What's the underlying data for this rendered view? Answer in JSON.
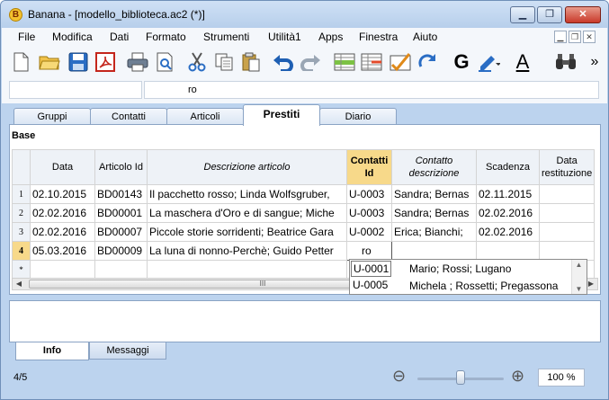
{
  "window": {
    "title": "Banana - [modello_biblioteca.ac2 (*)]",
    "minimize": "▁",
    "restore": "❐",
    "close": "✕"
  },
  "menubar": {
    "items": [
      "File",
      "Modifica",
      "Dati",
      "Formato",
      "Strumenti",
      "Utilità1",
      "Apps",
      "Finestra",
      "Aiuto"
    ],
    "mdi": [
      "▁",
      "❐",
      "✕"
    ]
  },
  "toolbar": {
    "icons": [
      "new-file-icon",
      "open-folder-icon",
      "save-icon",
      "pdf-icon",
      "print-icon",
      "print-preview-icon",
      "cut-icon",
      "copy-icon",
      "paste-icon",
      "undo-icon",
      "redo-icon",
      "insert-row-icon",
      "delete-row-icon",
      "check-icon",
      "refresh-icon",
      "bold-icon",
      "highlight-icon",
      "font-color-icon",
      "find-icon",
      "more-icon"
    ],
    "bold_label": "G",
    "font_color_label": "A",
    "more_label": "»"
  },
  "formula_bar": {
    "cell_ref": "",
    "value": "ro"
  },
  "tabs": [
    "Gruppi",
    "Contatti",
    "Articoli",
    "Prestiti",
    "Diario"
  ],
  "active_tab": "Prestiti",
  "section_label": "Base",
  "table": {
    "headers": [
      "Data",
      "Articolo Id",
      "Descrizione articolo",
      "Contatti Id",
      "Contatto descrizione",
      "Scadenza",
      "Data restituzione"
    ],
    "rows": [
      {
        "n": "1",
        "data": "02.10.2015",
        "articolo": "BD00143",
        "descrizione": "Il pacchetto rosso; Linda Wolfsgruber,",
        "contatti": "U-0003",
        "contatto_desc": "Sandra; Bernas",
        "scadenza": "02.11.2015",
        "restituzione": ""
      },
      {
        "n": "2",
        "data": "02.02.2016",
        "articolo": "BD00001",
        "descrizione": "La maschera d'Oro e di sangue; Miche",
        "contatti": "U-0003",
        "contatto_desc": "Sandra; Bernas",
        "scadenza": "02.02.2016",
        "restituzione": ""
      },
      {
        "n": "3",
        "data": "02.02.2016",
        "articolo": "BD00007",
        "descrizione": "Piccole storie sorridenti; Beatrice Gara",
        "contatti": "U-0002",
        "contatto_desc": "Erica; Bianchi;",
        "scadenza": "02.02.2016",
        "restituzione": ""
      },
      {
        "n": "4",
        "data": "05.03.2016",
        "articolo": "BD00009",
        "descrizione": "La luna di nonno-Perchè; Guido Petter",
        "contatti": "ro",
        "contatto_desc": "",
        "scadenza": "",
        "restituzione": ""
      }
    ],
    "new_row_marker": "*"
  },
  "autocomplete": [
    {
      "id": "U-0001",
      "desc": "Mario; Rossi; Lugano"
    },
    {
      "id": "U-0005",
      "desc": "Michela ; Rossetti; Pregassona"
    }
  ],
  "scroll": {
    "left": "◀",
    "right": "▶",
    "thumb": "III"
  },
  "bottom_tabs": [
    "Info",
    "Messaggi"
  ],
  "status": {
    "record": "4/5",
    "zoom_out": "⊖",
    "zoom_in": "⊕",
    "zoom": "100 %",
    "zoom_level_value": 0.5
  },
  "colors": {
    "accent_header": "#f7d98a",
    "chrome": "#bcd3ee"
  }
}
